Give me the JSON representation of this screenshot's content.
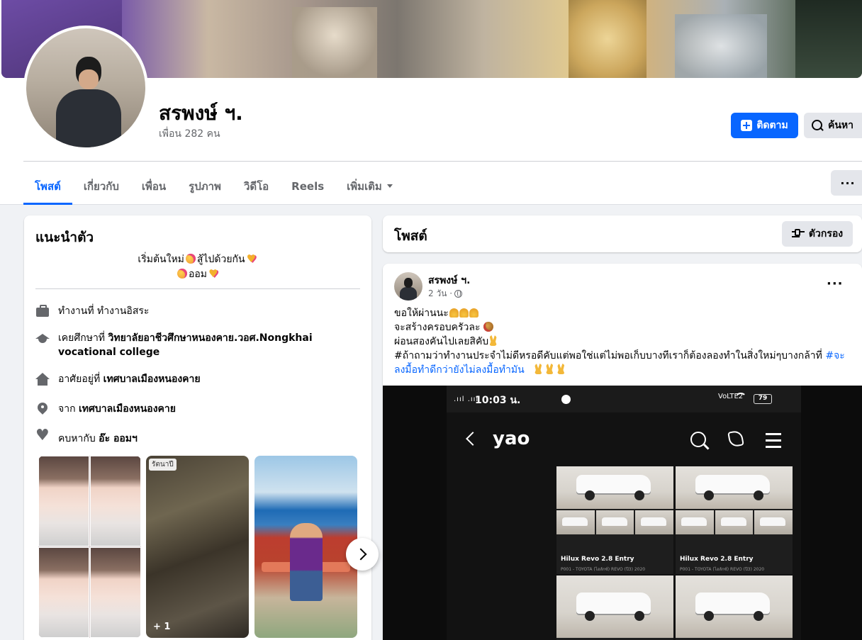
{
  "profile": {
    "name": "สรพงษ์ ฯ.",
    "friends": "เพื่อน 282 คน",
    "follow_label": "ติดตาม",
    "search_label": "ค้นหา"
  },
  "tabs": [
    {
      "label": "โพสต์",
      "active": true
    },
    {
      "label": "เกี่ยวกับ",
      "active": false
    },
    {
      "label": "เพื่อน",
      "active": false
    },
    {
      "label": "รูปภาพ",
      "active": false
    },
    {
      "label": "วิดีโอ",
      "active": false
    },
    {
      "label": "Reels",
      "active": false
    },
    {
      "label": "เพิ่มเติม",
      "active": false
    }
  ],
  "more_menu": "···",
  "intro": {
    "title": "แนะนำตัว",
    "bio_line1": "เริ่มต้นใหม่",
    "bio_line1b": "สู้ไปด้วยกัน",
    "bio_line2": "ออม",
    "work_prefix": "ทำงานที่ ",
    "work_value": "ทำงานอิสระ",
    "edu_prefix": "เคยศึกษาที่ ",
    "edu_value": "วิทยาลัยอาชีวศึกษาหนองคาย.วอศ.Nongkhai vocational college",
    "live_prefix": "อาศัยอยู่ที่ ",
    "live_value": "เทศบาลเมืองหนองคาย",
    "from_prefix": "จาก ",
    "from_value": "เทศบาลเมืองหนองคาย",
    "rel_prefix": "คบหากับ ",
    "rel_value": "อ๊ะ ออมฯ"
  },
  "photos": {
    "tag": "รัตนาปี",
    "more_count": "+ 1"
  },
  "posts_header": {
    "title": "โพสต์",
    "filter_label": "ตัวกรอง"
  },
  "post": {
    "author": "สรพงษ์ ฯ.",
    "time": "2 วัน ·",
    "menu": "···",
    "line1": "ขอให้ผ่านนะ",
    "line2": "จะสร้างครอบครัวละ",
    "line3": "ผ่อนสองคันไปเลยสิคับ",
    "line4": "#ถ้าถามว่าทำงานประจำไม่ดีหรอดีคับแต่พอใช่แต่ไม่พอเก็บบางทีเราก็ต้องลองทำในสิ่งใหม่ๆบางกล้าที่ ",
    "hashtag": "#จะลงมื้อทำดีกว่ายังไม่ลงมื้อทำมัน",
    "image": {
      "status_time": "10:03 น.",
      "net": "VoLTE2",
      "battery": "79",
      "app_title": "yao",
      "car_title_1": "Hilux Revo 2.8 Entry",
      "car_title_2": "Hilux Revo 2.8 Entry",
      "car_sub": "P001 - TOYOTA (ไฮลักซ์) REVO (ปี3) 2020"
    }
  }
}
